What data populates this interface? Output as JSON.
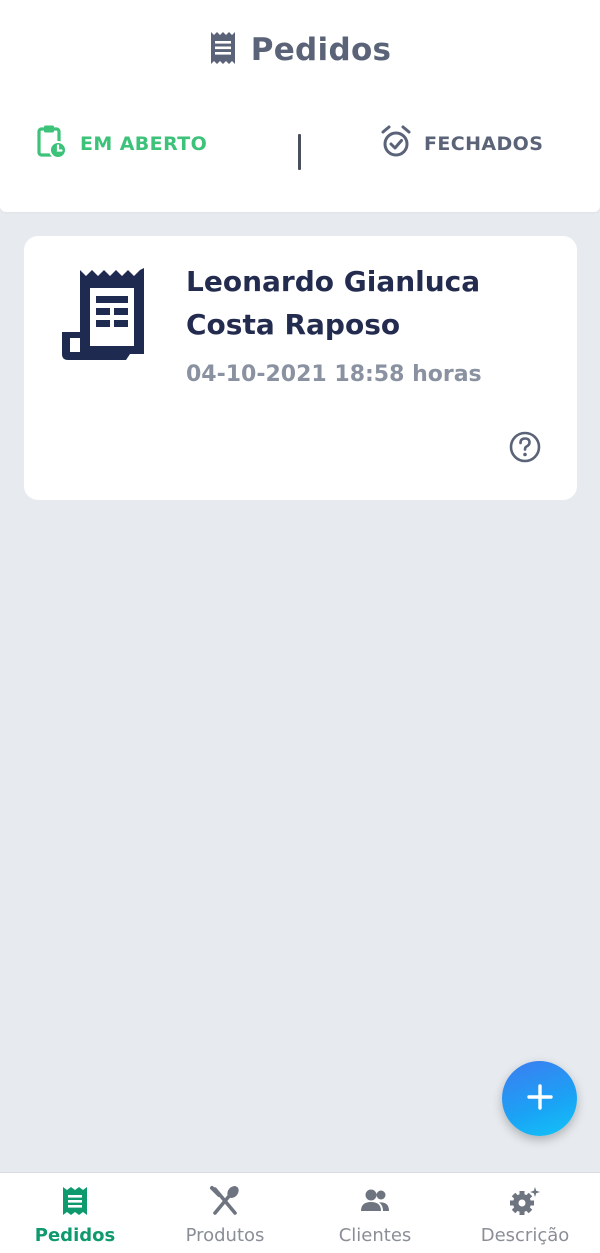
{
  "header": {
    "title": "Pedidos",
    "title_icon": "receipt-icon"
  },
  "tabs": [
    {
      "label": "EM ABERTO",
      "icon": "clipboard-clock-icon",
      "active": true,
      "color": "#3dc27a"
    },
    {
      "label": "FECHADOS",
      "icon": "alarm-check-icon",
      "active": false,
      "color": "#5a6377"
    }
  ],
  "orders": [
    {
      "customer": "Leonardo Gianluca Costa Raposo",
      "datetime": "04-10-2021 18:58 horas",
      "icon": "receipt-icon",
      "action_icon": "help-circle-icon"
    }
  ],
  "fab": {
    "icon": "plus-icon"
  },
  "bottom_nav": {
    "items": [
      {
        "label": "Pedidos",
        "icon": "receipt-icon",
        "active": true
      },
      {
        "label": "Produtos",
        "icon": "utensils-icon",
        "active": false
      },
      {
        "label": "Clientes",
        "icon": "users-icon",
        "active": false
      },
      {
        "label": "Descrição",
        "icon": "cog-sparkle-icon",
        "active": false
      }
    ]
  },
  "colors": {
    "accent_green": "#0f9a6e",
    "tab_active": "#3dc27a",
    "title": "#5a6377",
    "card_text": "#232c4f",
    "background": "#e7ebef"
  }
}
